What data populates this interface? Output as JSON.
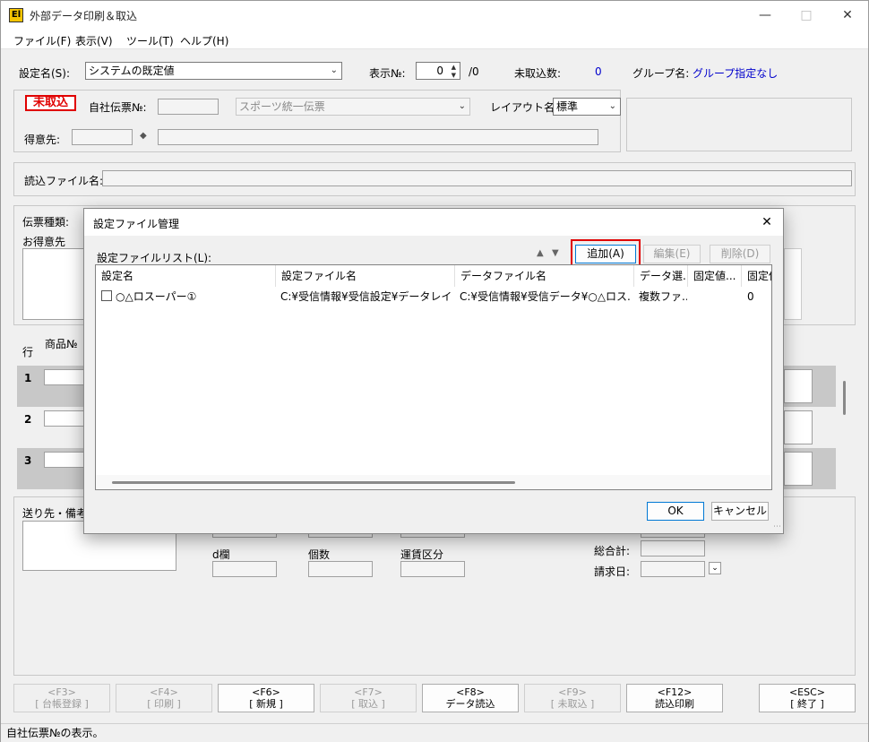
{
  "window": {
    "title": "外部データ印刷＆取込",
    "icon_text": "El"
  },
  "menu": [
    {
      "label": "ファイル(F)"
    },
    {
      "label": "表示(V)"
    },
    {
      "label": "ツール(T)"
    },
    {
      "label": "ヘルプ(H)"
    }
  ],
  "top": {
    "setting_label": "設定名(S):",
    "setting_value": "システムの既定値",
    "display_no_label": "表示№:",
    "display_no_value": "0",
    "display_no_total": "/0",
    "not_imported_label": "未取込数:",
    "not_imported_value": "0",
    "group_label": "グループ名:",
    "group_value": "グループ指定なし"
  },
  "header": {
    "status_stamp": "未取込",
    "company_slip_label": "自社伝票№:",
    "slip_type_value": "スポーツ統一伝票",
    "layout_label": "レイアウト名:",
    "layout_value": "標準",
    "customer_label": "得意先:"
  },
  "read_file_label": "読込ファイル名:",
  "slip_type_label": "伝票種類:",
  "customer_section_label": "お得意先",
  "grid": {
    "row_header": "行",
    "product_header": "商品№",
    "rows": [
      "1",
      "2",
      "3"
    ]
  },
  "footer_fields": {
    "remarks_label": "送り先・備考",
    "d_col_label": "d欄",
    "qty_label": "個数",
    "freight_label": "運賃区分",
    "total_label": "総合計:",
    "billing_date_label": "請求日:"
  },
  "function_keys": [
    {
      "key": "<F3>",
      "label": "[ 台帳登録 ]",
      "enabled": false
    },
    {
      "key": "<F4>",
      "label": "[ 印刷 ]",
      "enabled": false
    },
    {
      "key": "<F6>",
      "label": "[ 新規 ]",
      "enabled": true
    },
    {
      "key": "<F7>",
      "label": "[ 取込 ]",
      "enabled": false
    },
    {
      "key": "<F8>",
      "label": "データ読込",
      "enabled": true
    },
    {
      "key": "<F9>",
      "label": "[ 未取込 ]",
      "enabled": false
    },
    {
      "key": "<F12>",
      "label": "読込印刷",
      "enabled": true
    },
    {
      "key": "<ESC>",
      "label": "[ 終了 ]",
      "enabled": true
    }
  ],
  "status_bar": "自社伝票№の表示。",
  "dialog": {
    "title": "設定ファイル管理",
    "list_label": "設定ファイルリスト(L):",
    "add_button": "追加(A)",
    "edit_button": "編集(E)",
    "delete_button": "削除(D)",
    "columns": [
      "設定名",
      "設定ファイル名",
      "データファイル名",
      "データ選...",
      "固定値...",
      "固定値"
    ],
    "rows": [
      {
        "name": "○△ロスーパー①",
        "setting_file": "C:¥受信情報¥受信設定¥データレイア...",
        "data_file": "C:¥受信情報¥受信データ¥○△ロス...",
        "data_select": "複数ファ...",
        "fixed1": "",
        "fixed2": "0",
        "checked": false
      }
    ],
    "ok_button": "OK",
    "cancel_button": "キャンセル"
  }
}
